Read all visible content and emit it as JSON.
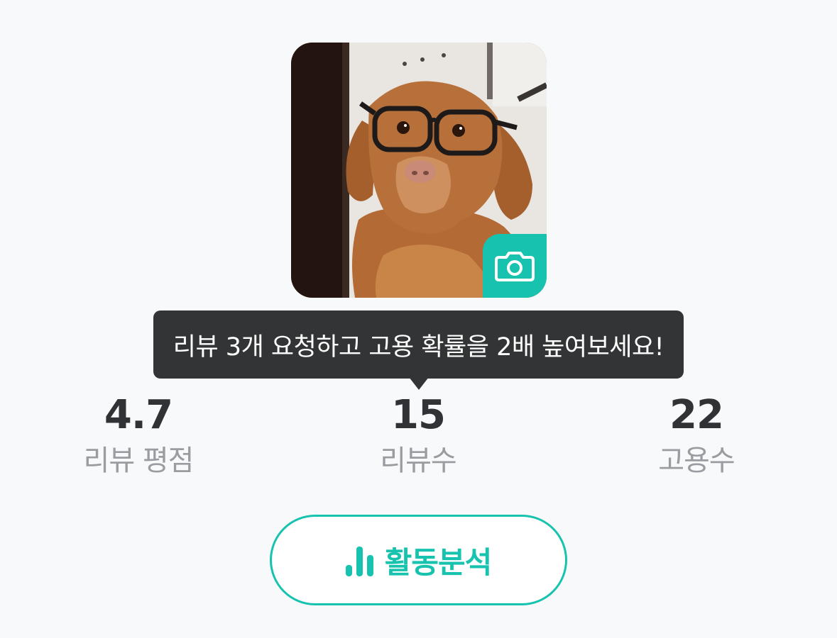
{
  "profile": {
    "camera_icon": "camera-icon"
  },
  "tooltip": {
    "text": "리뷰 3개 요청하고 고용 확률을 2배 높여보세요!"
  },
  "stats": {
    "rating": {
      "value": "4.7",
      "label": "리뷰 평점"
    },
    "reviews": {
      "value": "15",
      "label": "리뷰수"
    },
    "hires": {
      "value": "22",
      "label": "고용수"
    }
  },
  "activity_button": {
    "label": "활동분석",
    "icon": "bar-chart-icon"
  },
  "colors": {
    "accent": "#17c3ae",
    "tooltip_bg": "#333436",
    "value_text": "#303236",
    "label_text": "#9a9ca1",
    "page_bg": "#f8f9fa"
  }
}
